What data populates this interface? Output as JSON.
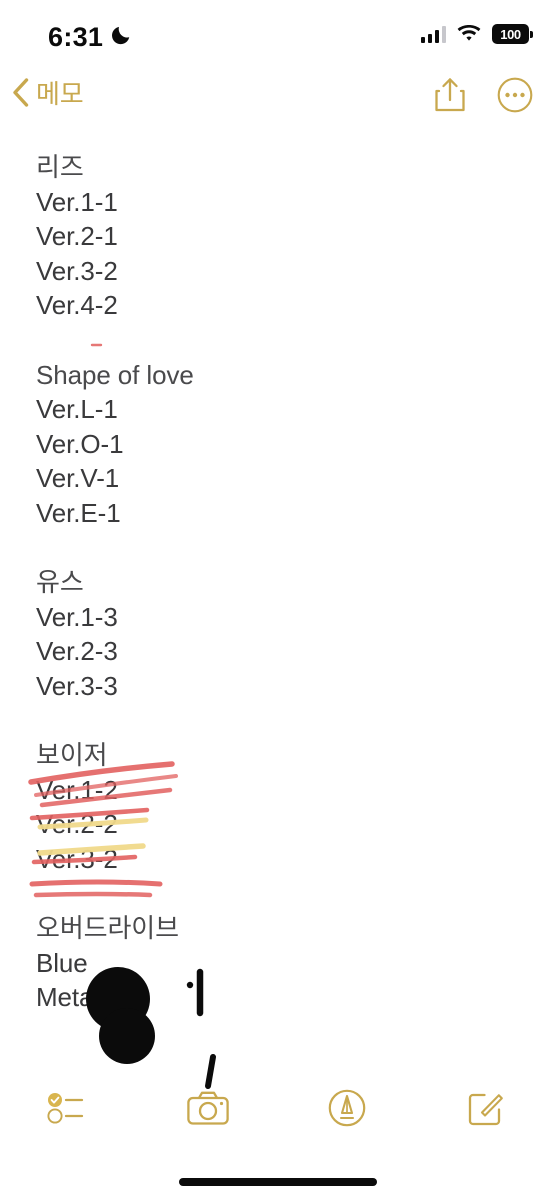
{
  "status_bar": {
    "time": "6:31",
    "dnd_icon": "moon-icon",
    "signal_icon": "cellular-signal-icon",
    "wifi_icon": "wifi-icon",
    "battery_level": "100",
    "battery_icon": "battery-full-icon"
  },
  "nav_bar": {
    "back_label": "메모",
    "back_icon": "chevron-left-icon",
    "share_icon": "share-icon",
    "more_icon": "more-circle-icon"
  },
  "note": {
    "sections": [
      {
        "heading": "리즈",
        "struck": false,
        "items": [
          "Ver.1-1",
          "Ver.2-1",
          "Ver.3-2",
          "Ver.4-2"
        ]
      },
      {
        "heading": "Shape of love",
        "struck": false,
        "items": [
          "Ver.L-1",
          "Ver.O-1",
          "Ver.V-1",
          "Ver.E-1"
        ]
      },
      {
        "heading": "유스",
        "struck": false,
        "items": [
          "Ver.1-3",
          "Ver.2-3",
          "Ver.3-3"
        ]
      },
      {
        "heading": "보이저",
        "struck": true,
        "items": [
          "Ver.1-2",
          "Ver.2-2",
          "Ver.3-2"
        ]
      },
      {
        "heading": "오버드라이브",
        "struck": false,
        "items": [
          "Blue",
          "Metal-"
        ]
      }
    ]
  },
  "annotations": {
    "strikethrough_color": "#e2605f",
    "highlight_color": "#f0d98a",
    "ink_color": "#0b0b0b",
    "marks": [
      "red-strikethrough-over-voyager-section",
      "yellow-highlight-over-voyager-items",
      "black-ink-blob-large",
      "black-ink-blob-small",
      "black-ink-stroke-vertical",
      "black-ink-stroke-dot",
      "black-ink-stroke-slanted"
    ]
  },
  "toolbar": {
    "items": [
      {
        "icon": "checklist-icon",
        "label": "Checklist"
      },
      {
        "icon": "camera-icon",
        "label": "Camera"
      },
      {
        "icon": "markup-pen-icon",
        "label": "Markup"
      },
      {
        "icon": "compose-icon",
        "label": "Compose"
      }
    ]
  },
  "colors": {
    "accent_gold": "#c8a84e",
    "text": "#3a3a3c",
    "background": "#ffffff"
  }
}
